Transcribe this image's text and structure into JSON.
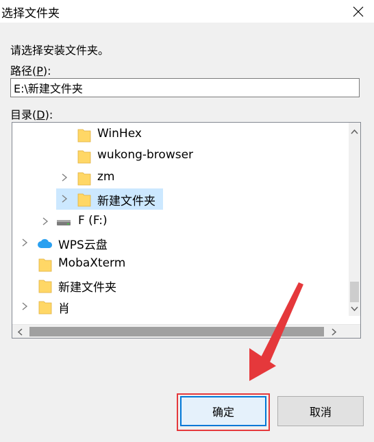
{
  "window": {
    "title": "选择文件夹"
  },
  "prompt": "请选择安装文件夹。",
  "path": {
    "label_prefix": "路径(",
    "label_key": "P",
    "label_suffix": "):",
    "value": "E:\\新建文件夹"
  },
  "directory": {
    "label_prefix": "目录(",
    "label_key": "D",
    "label_suffix": "):"
  },
  "tree_items": [
    {
      "label": "WinHex",
      "icon": "folder-icon",
      "expandable": false,
      "selected": false
    },
    {
      "label": "wukong-browser",
      "icon": "folder-icon",
      "expandable": false,
      "selected": false
    },
    {
      "label": "zm",
      "icon": "folder-icon",
      "expandable": true,
      "selected": false
    },
    {
      "label": "新建文件夹",
      "icon": "folder-icon",
      "expandable": true,
      "selected": true
    },
    {
      "label": "F (F:)",
      "icon": "drive-icon",
      "expandable": true,
      "selected": false
    },
    {
      "label": "WPS云盘",
      "icon": "cloud-icon",
      "expandable": true,
      "selected": false
    },
    {
      "label": "MobaXterm",
      "icon": "folder-icon",
      "expandable": false,
      "selected": false
    },
    {
      "label": "新建文件夹",
      "icon": "folder-icon",
      "expandable": false,
      "selected": false
    },
    {
      "label": "肖",
      "icon": "folder-icon",
      "expandable": true,
      "selected": false
    }
  ],
  "buttons": {
    "ok": "确定",
    "cancel": "取消"
  },
  "colors": {
    "selection": "#cce8ff",
    "folder": "#ffd766",
    "annotation": "#e5383b",
    "primary_border": "#0078d7"
  }
}
